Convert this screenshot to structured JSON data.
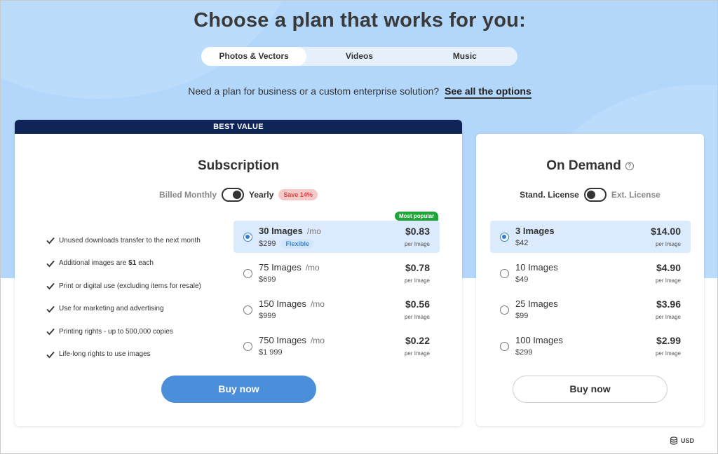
{
  "header": {
    "title": "Choose a plan that works for you:",
    "tabs": [
      {
        "label": "Photos & Vectors",
        "active": true
      },
      {
        "label": "Videos",
        "active": false
      },
      {
        "label": "Music",
        "active": false
      }
    ],
    "subtitle": "Need a plan for business or a custom enterprise solution?",
    "subtitle_link": "See all the options"
  },
  "subscription": {
    "banner": "BEST VALUE",
    "title": "Subscription",
    "billing_left": "Billed Monthly",
    "billing_right": "Yearly",
    "save_badge": "Save 14%",
    "features": [
      {
        "pre": "Unused downloads transfer to the next month",
        "bold": "",
        "post": ""
      },
      {
        "pre": "Additional images are",
        "bold": "$1",
        "post": "each"
      },
      {
        "pre": "Print or digital use (excluding items for resale)",
        "bold": "",
        "post": ""
      },
      {
        "pre": "Use for marketing and advertising",
        "bold": "",
        "post": ""
      },
      {
        "pre": "Printing rights - up to 500,000 copies",
        "bold": "",
        "post": ""
      },
      {
        "pre": "Life-long rights to use images",
        "bold": "",
        "post": ""
      }
    ],
    "popular_badge": "Most popular",
    "options": [
      {
        "name": "30 Images",
        "per": "/mo",
        "price": "$299",
        "badge": "Flexible",
        "unit_price": "$0.83",
        "unit_label": "per Image",
        "selected": true
      },
      {
        "name": "75 Images",
        "per": "/mo",
        "price": "$699",
        "badge": "",
        "unit_price": "$0.78",
        "unit_label": "per Image",
        "selected": false
      },
      {
        "name": "150 Images",
        "per": "/mo",
        "price": "$999",
        "badge": "",
        "unit_price": "$0.56",
        "unit_label": "per Image",
        "selected": false
      },
      {
        "name": "750 Images",
        "per": "/mo",
        "price": "$1 999",
        "badge": "",
        "unit_price": "$0.22",
        "unit_label": "per Image",
        "selected": false
      }
    ],
    "buy_label": "Buy now"
  },
  "on_demand": {
    "title": "On Demand",
    "license_left": "Stand. License",
    "license_right": "Ext. License",
    "options": [
      {
        "name": "3 Images",
        "price": "$42",
        "unit_price": "$14.00",
        "unit_label": "per Image",
        "selected": true
      },
      {
        "name": "10 Images",
        "price": "$49",
        "unit_price": "$4.90",
        "unit_label": "per Image",
        "selected": false
      },
      {
        "name": "25 Images",
        "price": "$99",
        "unit_price": "$3.96",
        "unit_label": "per Image",
        "selected": false
      },
      {
        "name": "100 Images",
        "price": "$299",
        "unit_price": "$2.99",
        "unit_label": "per Image",
        "selected": false
      }
    ],
    "buy_label": "Buy now"
  },
  "footer": {
    "currency": "USD",
    "currency_icon": "coins-icon"
  },
  "colors": {
    "hero_background": "#b3d7fa",
    "banner": "#0f2557",
    "primary_button": "#4b8fdb",
    "selected_row": "#dbeafc",
    "popular_badge": "#20a53a",
    "save_badge_bg": "#f6c9c9"
  }
}
